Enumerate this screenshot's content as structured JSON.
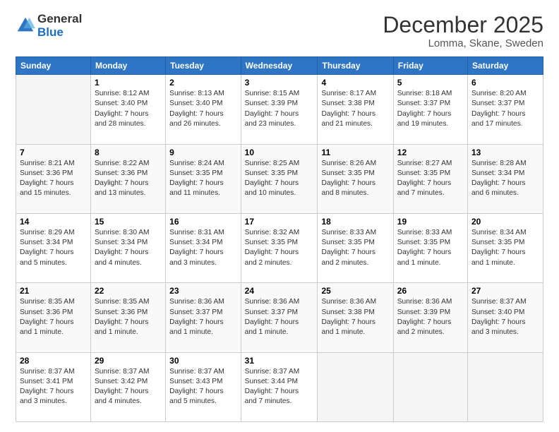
{
  "logo": {
    "general": "General",
    "blue": "Blue"
  },
  "header": {
    "month": "December 2025",
    "location": "Lomma, Skane, Sweden"
  },
  "days_of_week": [
    "Sunday",
    "Monday",
    "Tuesday",
    "Wednesday",
    "Thursday",
    "Friday",
    "Saturday"
  ],
  "weeks": [
    [
      {
        "day": "",
        "info": ""
      },
      {
        "day": "1",
        "info": "Sunrise: 8:12 AM\nSunset: 3:40 PM\nDaylight: 7 hours\nand 28 minutes."
      },
      {
        "day": "2",
        "info": "Sunrise: 8:13 AM\nSunset: 3:40 PM\nDaylight: 7 hours\nand 26 minutes."
      },
      {
        "day": "3",
        "info": "Sunrise: 8:15 AM\nSunset: 3:39 PM\nDaylight: 7 hours\nand 23 minutes."
      },
      {
        "day": "4",
        "info": "Sunrise: 8:17 AM\nSunset: 3:38 PM\nDaylight: 7 hours\nand 21 minutes."
      },
      {
        "day": "5",
        "info": "Sunrise: 8:18 AM\nSunset: 3:37 PM\nDaylight: 7 hours\nand 19 minutes."
      },
      {
        "day": "6",
        "info": "Sunrise: 8:20 AM\nSunset: 3:37 PM\nDaylight: 7 hours\nand 17 minutes."
      }
    ],
    [
      {
        "day": "7",
        "info": "Sunrise: 8:21 AM\nSunset: 3:36 PM\nDaylight: 7 hours\nand 15 minutes."
      },
      {
        "day": "8",
        "info": "Sunrise: 8:22 AM\nSunset: 3:36 PM\nDaylight: 7 hours\nand 13 minutes."
      },
      {
        "day": "9",
        "info": "Sunrise: 8:24 AM\nSunset: 3:35 PM\nDaylight: 7 hours\nand 11 minutes."
      },
      {
        "day": "10",
        "info": "Sunrise: 8:25 AM\nSunset: 3:35 PM\nDaylight: 7 hours\nand 10 minutes."
      },
      {
        "day": "11",
        "info": "Sunrise: 8:26 AM\nSunset: 3:35 PM\nDaylight: 7 hours\nand 8 minutes."
      },
      {
        "day": "12",
        "info": "Sunrise: 8:27 AM\nSunset: 3:35 PM\nDaylight: 7 hours\nand 7 minutes."
      },
      {
        "day": "13",
        "info": "Sunrise: 8:28 AM\nSunset: 3:34 PM\nDaylight: 7 hours\nand 6 minutes."
      }
    ],
    [
      {
        "day": "14",
        "info": "Sunrise: 8:29 AM\nSunset: 3:34 PM\nDaylight: 7 hours\nand 5 minutes."
      },
      {
        "day": "15",
        "info": "Sunrise: 8:30 AM\nSunset: 3:34 PM\nDaylight: 7 hours\nand 4 minutes."
      },
      {
        "day": "16",
        "info": "Sunrise: 8:31 AM\nSunset: 3:34 PM\nDaylight: 7 hours\nand 3 minutes."
      },
      {
        "day": "17",
        "info": "Sunrise: 8:32 AM\nSunset: 3:35 PM\nDaylight: 7 hours\nand 2 minutes."
      },
      {
        "day": "18",
        "info": "Sunrise: 8:33 AM\nSunset: 3:35 PM\nDaylight: 7 hours\nand 2 minutes."
      },
      {
        "day": "19",
        "info": "Sunrise: 8:33 AM\nSunset: 3:35 PM\nDaylight: 7 hours\nand 1 minute."
      },
      {
        "day": "20",
        "info": "Sunrise: 8:34 AM\nSunset: 3:35 PM\nDaylight: 7 hours\nand 1 minute."
      }
    ],
    [
      {
        "day": "21",
        "info": "Sunrise: 8:35 AM\nSunset: 3:36 PM\nDaylight: 7 hours\nand 1 minute."
      },
      {
        "day": "22",
        "info": "Sunrise: 8:35 AM\nSunset: 3:36 PM\nDaylight: 7 hours\nand 1 minute."
      },
      {
        "day": "23",
        "info": "Sunrise: 8:36 AM\nSunset: 3:37 PM\nDaylight: 7 hours\nand 1 minute."
      },
      {
        "day": "24",
        "info": "Sunrise: 8:36 AM\nSunset: 3:37 PM\nDaylight: 7 hours\nand 1 minute."
      },
      {
        "day": "25",
        "info": "Sunrise: 8:36 AM\nSunset: 3:38 PM\nDaylight: 7 hours\nand 1 minute."
      },
      {
        "day": "26",
        "info": "Sunrise: 8:36 AM\nSunset: 3:39 PM\nDaylight: 7 hours\nand 2 minutes."
      },
      {
        "day": "27",
        "info": "Sunrise: 8:37 AM\nSunset: 3:40 PM\nDaylight: 7 hours\nand 3 minutes."
      }
    ],
    [
      {
        "day": "28",
        "info": "Sunrise: 8:37 AM\nSunset: 3:41 PM\nDaylight: 7 hours\nand 3 minutes."
      },
      {
        "day": "29",
        "info": "Sunrise: 8:37 AM\nSunset: 3:42 PM\nDaylight: 7 hours\nand 4 minutes."
      },
      {
        "day": "30",
        "info": "Sunrise: 8:37 AM\nSunset: 3:43 PM\nDaylight: 7 hours\nand 5 minutes."
      },
      {
        "day": "31",
        "info": "Sunrise: 8:37 AM\nSunset: 3:44 PM\nDaylight: 7 hours\nand 7 minutes."
      },
      {
        "day": "",
        "info": ""
      },
      {
        "day": "",
        "info": ""
      },
      {
        "day": "",
        "info": ""
      }
    ]
  ]
}
